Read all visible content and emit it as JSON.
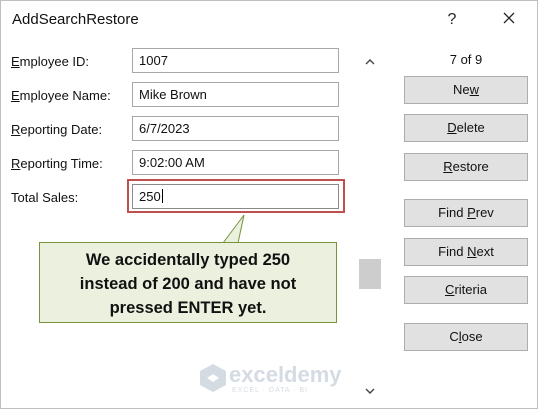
{
  "window": {
    "title": "AddSearchRestore",
    "help_glyph": "?"
  },
  "fields": [
    {
      "label_u": "E",
      "label_rest": "mployee ID:",
      "value": "1007"
    },
    {
      "label_u": "E",
      "label_rest": "mployee Name:",
      "value": "Mike Brown"
    },
    {
      "label_u": "R",
      "label_rest": "eporting Date:",
      "value": "6/7/2023"
    },
    {
      "label_u": "R",
      "label_rest": "eporting Time:",
      "value": "9:02:00 AM"
    },
    {
      "label_u": "",
      "label_rest": "Total Sales:",
      "value": "250"
    }
  ],
  "record_counter": "7 of 9",
  "buttons": {
    "new": {
      "pre": "Ne",
      "u": "w",
      "post": ""
    },
    "delete": {
      "pre": "",
      "u": "D",
      "post": "elete"
    },
    "restore": {
      "pre": "",
      "u": "R",
      "post": "estore"
    },
    "find_prev": {
      "pre": "Find ",
      "u": "P",
      "post": "rev"
    },
    "find_next": {
      "pre": "Find ",
      "u": "N",
      "post": "ext"
    },
    "criteria": {
      "pre": "",
      "u": "C",
      "post": "riteria"
    },
    "close": {
      "pre": "C",
      "u": "l",
      "post": "ose"
    }
  },
  "callout": {
    "text": "We accidentally typed 250\ninstead of 200 and have not\npressed ENTER yet."
  },
  "watermark": {
    "name": "exceldemy",
    "tagline": "EXCEL · DATA · BI"
  },
  "colors": {
    "highlight_border": "#c0504d",
    "callout_fill": "#ebf1de",
    "callout_border": "#77933c",
    "button_fill": "#e1e1e1",
    "scroll_thumb": "#cdcdcd"
  },
  "icons": [
    "close-icon",
    "scroll-up-icon",
    "scroll-down-icon",
    "exceldemy-logo-icon"
  ]
}
